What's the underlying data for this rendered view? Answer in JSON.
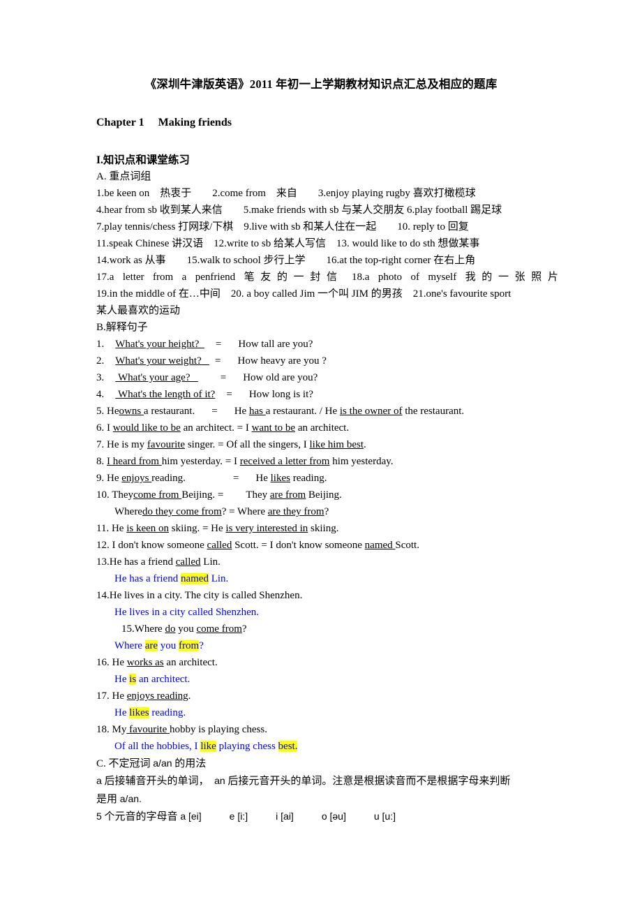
{
  "document": {
    "title": "《深圳牛津版英语》2011 年初一上学期教材知识点汇总及相应的题库",
    "chapter": {
      "label": "Chapter 1",
      "name": "Making friends"
    },
    "section_i": "I.知识点和课堂练习"
  },
  "part_a": {
    "heading": "A. 重点词组",
    "lines": [
      "1.be keen on　热衷于　　2.come from　来自　　3.enjoy playing rugby 喜欢打橄榄球",
      "4.hear from sb 收到某人来信　　5.make friends with sb 与某人交朋友 6.play football 踢足球",
      "7.play tennis/chess 打网球/下棋　9.live with sb 和某人住在一起　　10. reply to 回复",
      "11.speak Chinese 讲汉语　12.write to sb 给某人写信　13. would like to do sth 想做某事",
      "14.work as 从事　　15.walk to school 步行上学　　16.at the top-right corner 在右上角",
      "17.a letter from a penfriend 笔友的一封信　18.a photo of myself 我的一张照片",
      "19.in the middle of 在…中间　20. a boy called Jim 一个叫 JIM 的男孩　21.one's favourite sport",
      "某人最喜欢的运动"
    ],
    "line17_parts": {
      "a": "17.a letter from a penfriend",
      "b": "笔友的一封信",
      "c": "18.a photo of myself",
      "d": "我的一张照片"
    },
    "line_wrap_tail": "某人最喜欢的运动"
  },
  "part_b": {
    "heading": "B.解释句子",
    "items": [
      {
        "num": "1.",
        "left_u": "What's your height?",
        "eq": "=",
        "right": "How tall are you?"
      },
      {
        "num": "2.",
        "left_u": "What's your weight?",
        "eq": "=",
        "right": "How heavy are you ?"
      },
      {
        "num": "3.",
        "left_u": "What's your age?",
        "eq": "=",
        "right": "How old are you?"
      },
      {
        "num": "4.",
        "left_u": "What's the length of it?",
        "eq": "=",
        "right": "How long is it?"
      }
    ],
    "item5": {
      "num": "5.",
      "a1": "He",
      "u1": "owns",
      "a2": "a restaurant.",
      "eq": "=",
      "b1": "He",
      "u2": "has",
      "b2": "a restaurant. / He",
      "u3": "is the owner of",
      "b3": "the restaurant."
    },
    "item6": {
      "num": "6.",
      "a1": "I",
      "u1": "would like to be",
      "a2": "an architect. = I",
      "u2": "want to be",
      "a3": "an architect."
    },
    "item7": {
      "num": "7.",
      "a1": "He is my",
      "u1": "favourite",
      "a2": "singer. = Of all the singers, I",
      "u2": "like him best",
      "a3": "."
    },
    "item8": {
      "num": "8.",
      "u1": "I heard from",
      "a1": "him yesterday. = I",
      "u2": "received a letter from",
      "a2": "him yesterday."
    },
    "item9": {
      "num": "9.",
      "a1": "He",
      "u1": "enjoys",
      "a2": "reading.",
      "eq": "=",
      "b1": "He",
      "u2": "likes",
      "b2": "reading."
    },
    "item10": {
      "num": "10.",
      "a1": "They",
      "u1": "come from",
      "a2": "Beijing.",
      "eq": "=",
      "b1": "They",
      "u2": "are from",
      "b2": "Beijing.",
      "sub_a1": "Where",
      "sub_u1": "do they come from",
      "sub_a2": "? = Where",
      "sub_u2": "are they from",
      "sub_a3": "?"
    },
    "item11": {
      "num": "11.",
      "a1": "He",
      "u1": "is keen on",
      "a2": "skiing. = He",
      "u2": "is very interested in",
      "a3": "skiing."
    },
    "item12": {
      "num": "12.",
      "a1": "I don't know someone",
      "u1": "called",
      "a2": "Scott. = I don't know someone",
      "u2": "named",
      "a3": "Scott."
    },
    "item13": {
      "num": "13.",
      "a1": "He has a friend",
      "u1": "called",
      "a2": "Lin.",
      "ans_pre": "He has a friend ",
      "ans_hl": "named",
      "ans_post": " Lin."
    },
    "item14": {
      "num": "14.",
      "a1": "He lives in a city. The city is called Shenzhen.",
      "ans": "He lives in a city called Shenzhen."
    },
    "item15": {
      "num": "15.",
      "a1": "Where",
      "u1": "do",
      "a2": "you",
      "u2": "come from",
      "a3": "?",
      "ans_pre": "Where ",
      "ans_hl1": "are",
      "ans_mid": " you ",
      "ans_hl2": "from",
      "ans_post": "?"
    },
    "item16": {
      "num": "16.",
      "a1": "He",
      "u1": "works as",
      "a2": "an architect.",
      "ans_pre": "He ",
      "ans_hl": "is",
      "ans_post": " an architect."
    },
    "item17": {
      "num": "17.",
      "a1": "He",
      "u1": "enjoys reading",
      "a2": ".",
      "ans_pre": "He ",
      "ans_hl": "likes",
      "ans_post": " reading."
    },
    "item18": {
      "num": "18.",
      "a1": "My",
      "u1": "favourite",
      "a2": "hobby is playing chess.",
      "ans_pre": "Of all the hobbies, I ",
      "ans_hl1": "like",
      "ans_mid": " playing chess ",
      "ans_hl2": "best."
    }
  },
  "part_c": {
    "heading_pre": "C. 不定冠词 ",
    "heading_code": "a/an",
    "heading_post": " 的用法",
    "rule_p1_a": "a",
    "rule_p1_b": " 后接辅音开头的单词，　",
    "rule_p1_c": "an",
    "rule_p1_d": " 后接元音开头的单词。注意是根据读音而不是根据字母来判断",
    "rule_p2_a": "是用 ",
    "rule_p2_b": "a/an.",
    "vowels_label_num": "5",
    "vowels_label_text": " 个元音的字母音 ",
    "vowels": [
      "a [ei]",
      "e [i:]",
      "i [ai]",
      "o [əu]",
      "u [u:]"
    ]
  },
  "colors": {
    "text": "#000000",
    "answer_blue": "#0000ff",
    "highlight_yellow": "#ffff00",
    "page_background": "#ffffff"
  }
}
